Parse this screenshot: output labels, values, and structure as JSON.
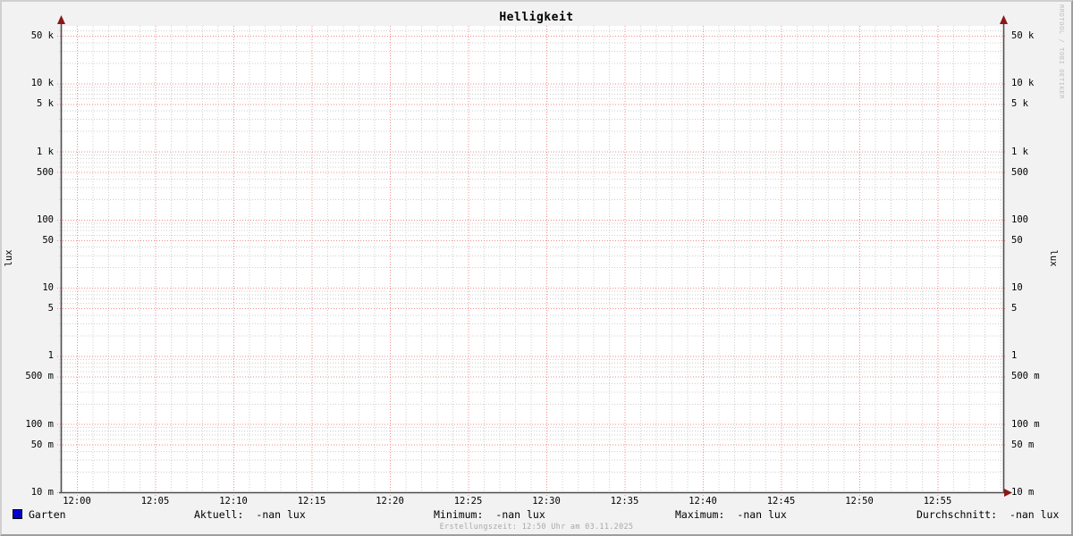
{
  "title": "Helligkeit",
  "watermark": "RRDTOOL / TOBI OETIKER",
  "footer": "Erstellungszeit: 12:50 Uhr am 03.11.2025",
  "y_axis_label": "lux",
  "legend": {
    "series_label": "Garten",
    "swatch_color": "#0000d0",
    "stats": [
      {
        "label": "Aktuell:",
        "value": "-nan lux"
      },
      {
        "label": "Minimum:",
        "value": "-nan lux"
      },
      {
        "label": "Maximum:",
        "value": "-nan lux"
      },
      {
        "label": "Durchschnitt:",
        "value": "-nan lux"
      }
    ]
  },
  "colors": {
    "background": "#f2f2f2",
    "canvas": "#ffffff",
    "major_grid": "#f28b8b",
    "minor_grid": "#cfcfcf",
    "axis": "#4f4f4f",
    "arrow": "#8b1717",
    "watermark_text": "#bdbdbd",
    "footer_text": "#a9a9a9",
    "shade_top_left": "#d0d0d0",
    "shade_bottom_right": "#9e9e9e"
  },
  "chart_data": {
    "type": "line",
    "title": "Helligkeit",
    "ylabel": "lux",
    "y_scale": "logarithmic",
    "ylim": [
      0.01,
      69500
    ],
    "grid": true,
    "legend_position": "bottom",
    "x_tick_interval_minutes": 5,
    "x_minor_interval_minutes": 1,
    "x_ticks": [
      "12:00",
      "12:05",
      "12:10",
      "12:15",
      "12:20",
      "12:25",
      "12:30",
      "12:35",
      "12:40",
      "12:45",
      "12:50",
      "12:55"
    ],
    "y_ticks": [
      {
        "value": 0.01,
        "label": "10 m"
      },
      {
        "value": 0.05,
        "label": "50 m"
      },
      {
        "value": 0.1,
        "label": "100 m"
      },
      {
        "value": 0.5,
        "label": "500 m"
      },
      {
        "value": 1,
        "label": "1"
      },
      {
        "value": 5,
        "label": "5"
      },
      {
        "value": 10,
        "label": "10"
      },
      {
        "value": 50,
        "label": "50"
      },
      {
        "value": 100,
        "label": "100"
      },
      {
        "value": 500,
        "label": "500"
      },
      {
        "value": 1000,
        "label": "1 k"
      },
      {
        "value": 5000,
        "label": "5 k"
      },
      {
        "value": 10000,
        "label": "10 k"
      },
      {
        "value": 50000,
        "label": "50 k"
      }
    ],
    "y_minor_multipliers": [
      2,
      3,
      4,
      6,
      7,
      8,
      9
    ],
    "series": [
      {
        "name": "Garten",
        "color": "#0000d0",
        "values": []
      }
    ]
  }
}
